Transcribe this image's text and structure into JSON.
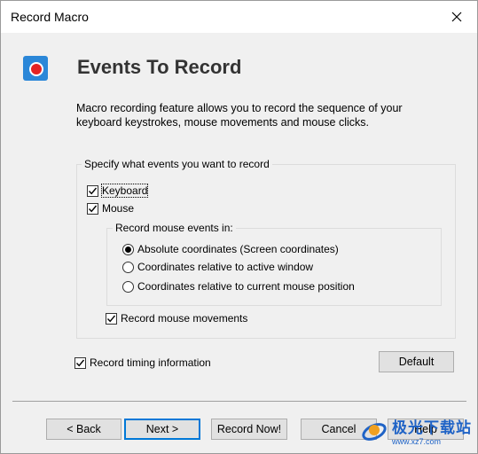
{
  "window": {
    "title": "Record Macro"
  },
  "header": {
    "icon": "record-icon",
    "title": "Events To Record"
  },
  "description": "Macro recording feature allows you to record the sequence of your keyboard keystrokes, mouse movements and mouse clicks.",
  "events_group": {
    "legend": "Specify what events you want to record",
    "keyboard": {
      "label": "Keyboard",
      "checked": true
    },
    "mouse": {
      "label": "Mouse",
      "checked": true
    },
    "mouse_events_group": {
      "legend": "Record mouse events in:",
      "options": [
        {
          "label": "Absolute coordinates (Screen coordinates)",
          "selected": true
        },
        {
          "label": "Coordinates relative to active window",
          "selected": false
        },
        {
          "label": "Coordinates relative to current mouse position",
          "selected": false
        }
      ]
    },
    "record_movements": {
      "label": "Record mouse movements",
      "checked": true
    }
  },
  "timing": {
    "label": "Record timing information",
    "checked": true
  },
  "buttons": {
    "default": "Default",
    "back": "< Back",
    "next": "Next >",
    "record_now": "Record Now!",
    "cancel": "Cancel",
    "help": "Help"
  },
  "watermark": {
    "text": "极光下载站",
    "url": "www.xz7.com"
  },
  "colors": {
    "accent": "#0078d7",
    "icon_bg": "#2b87d8",
    "record_red": "#e42222",
    "watermark": "#1f63c6"
  }
}
